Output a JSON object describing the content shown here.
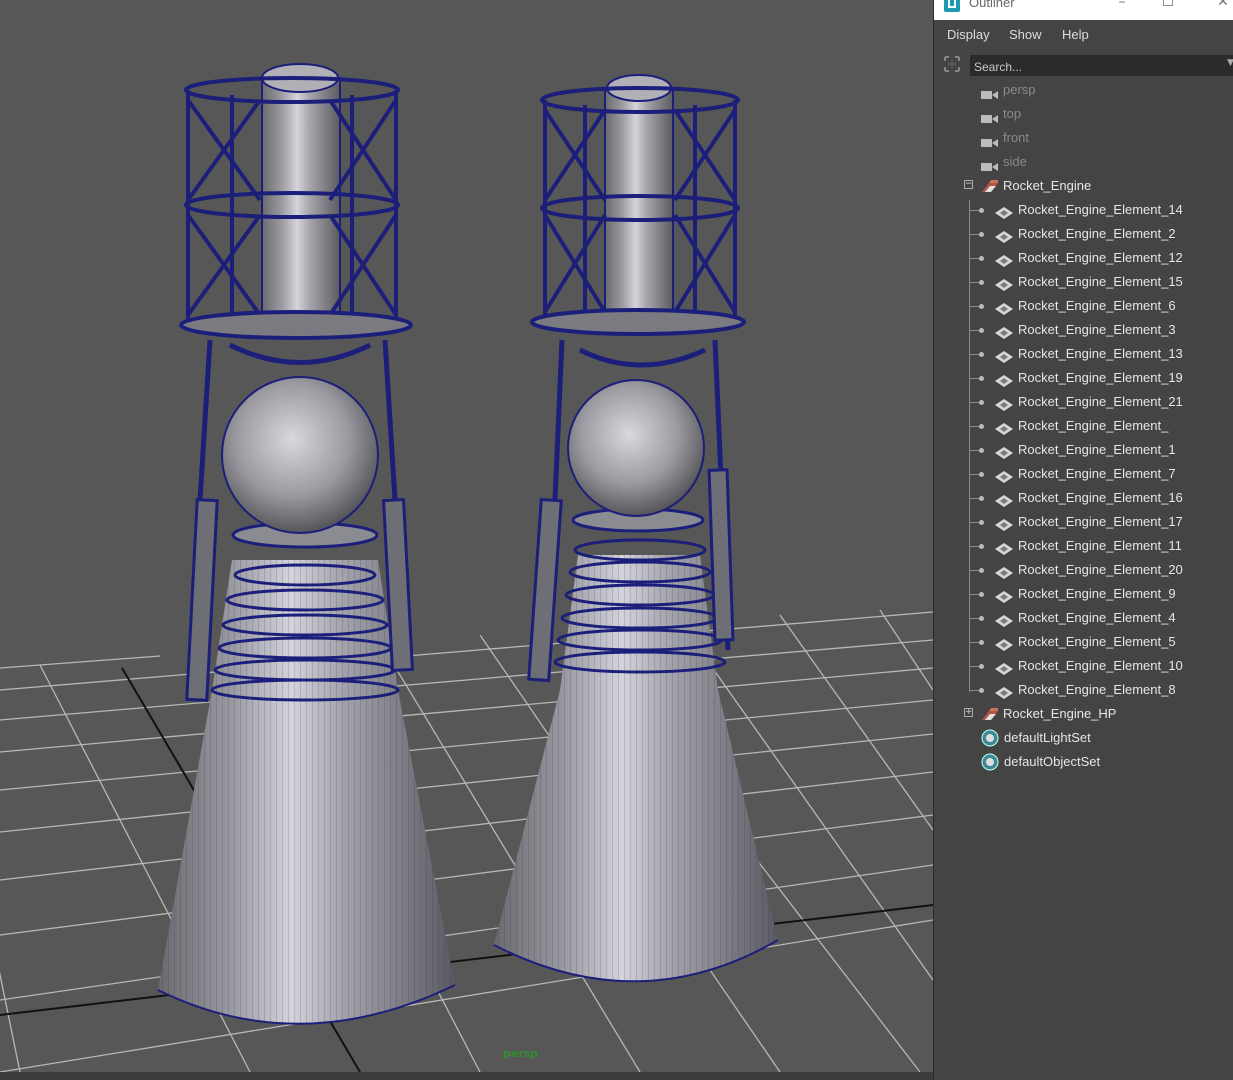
{
  "viewport": {
    "camera_label": "persp",
    "background": "#575757",
    "wire_color": "#1c1f7a"
  },
  "outliner": {
    "title": "Outliner",
    "window_buttons": [
      "minimize",
      "maximize",
      "close"
    ],
    "menu": [
      "Display",
      "Show",
      "Help"
    ],
    "search_placeholder": "Search...",
    "cameras": [
      "persp",
      "top",
      "front",
      "side"
    ],
    "group": {
      "name": "Rocket_Engine",
      "expanded": true,
      "children": [
        "Rocket_Engine_Element_14",
        "Rocket_Engine_Element_2",
        "Rocket_Engine_Element_12",
        "Rocket_Engine_Element_15",
        "Rocket_Engine_Element_6",
        "Rocket_Engine_Element_3",
        "Rocket_Engine_Element_13",
        "Rocket_Engine_Element_19",
        "Rocket_Engine_Element_21",
        "Rocket_Engine_Element_",
        "Rocket_Engine_Element_1",
        "Rocket_Engine_Element_7",
        "Rocket_Engine_Element_16",
        "Rocket_Engine_Element_17",
        "Rocket_Engine_Element_11",
        "Rocket_Engine_Element_20",
        "Rocket_Engine_Element_9",
        "Rocket_Engine_Element_4",
        "Rocket_Engine_Element_5",
        "Rocket_Engine_Element_10",
        "Rocket_Engine_Element_8"
      ]
    },
    "group2": {
      "name": "Rocket_Engine_HP",
      "expanded": false
    },
    "sets": [
      "defaultLightSet",
      "defaultObjectSet"
    ]
  }
}
